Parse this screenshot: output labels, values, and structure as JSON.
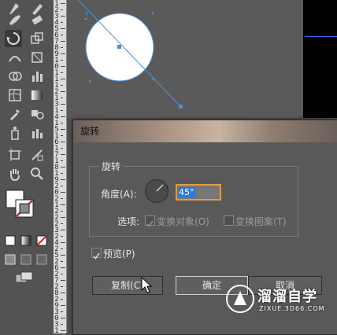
{
  "dialog": {
    "title": "旋转",
    "group_title": "旋转",
    "angle_label": "角度(A):",
    "angle_value": "45°",
    "options_label": "选项:",
    "transform_objects": "变换对象(O)",
    "transform_patterns": "变换图案(T)",
    "preview_label": "预览(P)",
    "copy_button": "复制(C)",
    "ok_button": "确定",
    "cancel_button": "取消"
  },
  "ruler": {
    "labels": [
      "1",
      "2",
      "3",
      "4",
      "5",
      "6",
      "7",
      "8",
      "9",
      "1",
      "0",
      "1",
      "1",
      "1",
      "2",
      "1",
      "3",
      "1",
      "4",
      "1",
      "5",
      "1",
      "6",
      "1",
      "7",
      "1",
      "8",
      "1",
      "9",
      "2",
      "0",
      "2",
      "1",
      "2",
      "2",
      "2",
      "3",
      "2",
      "4",
      "2",
      "5",
      "2",
      "6",
      "2",
      "7",
      "2",
      "8",
      "2",
      "9",
      "3",
      "0",
      "3",
      "1"
    ]
  },
  "watermark": {
    "name": "溜溜自学",
    "url": "ZIXUE.3D66.COM"
  }
}
